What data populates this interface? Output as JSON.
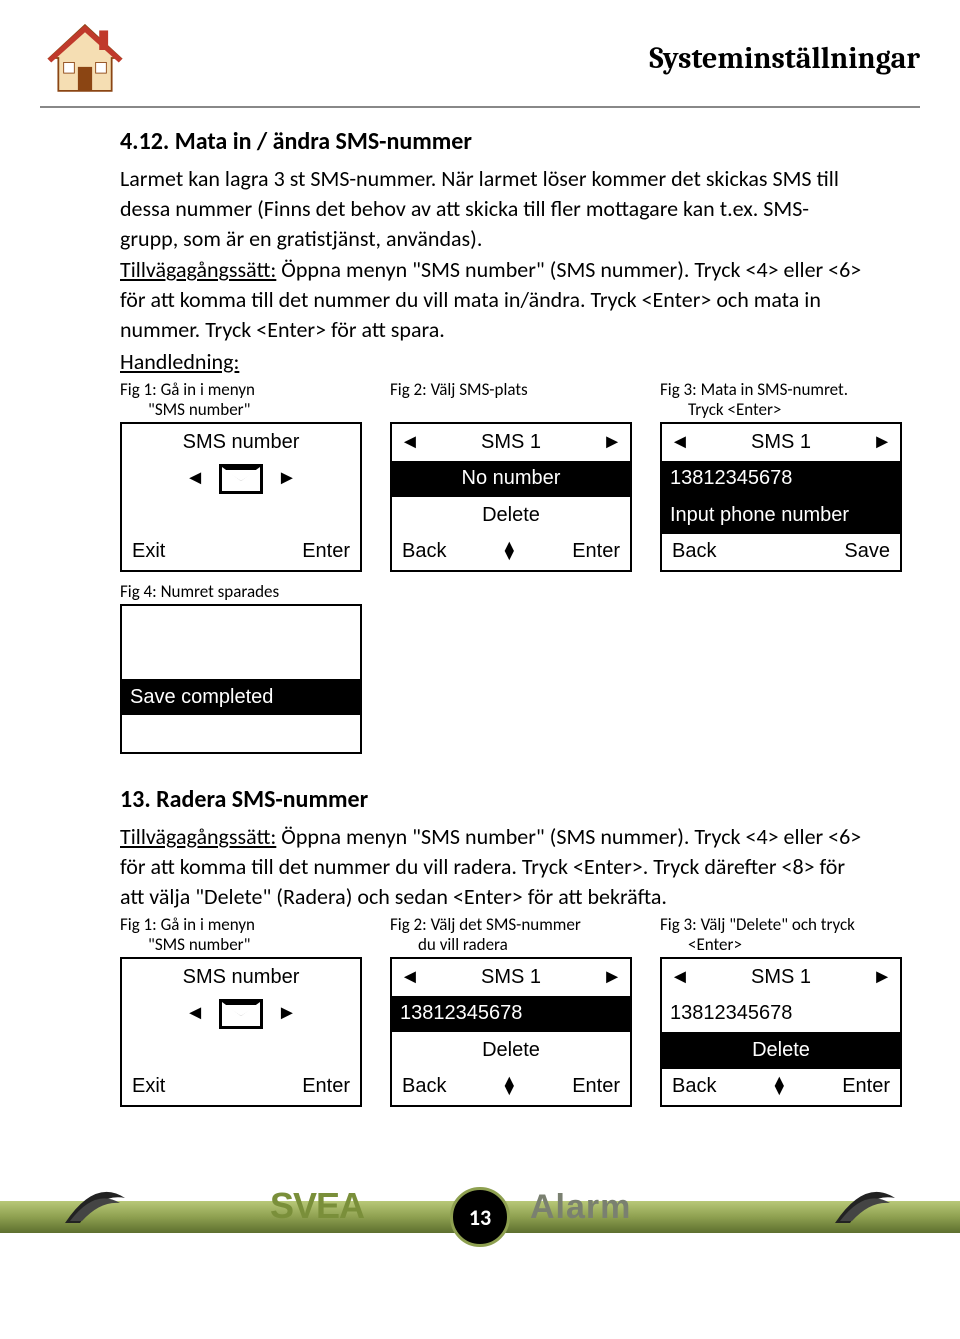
{
  "header": {
    "title": "Systeminställningar"
  },
  "section1": {
    "title": "4.12. Mata in / ändra SMS-nummer",
    "p1": "Larmet kan lagra 3 st SMS-nummer. När larmet löser kommer det skickas SMS till dessa nummer (Finns det behov av att skicka till fler mottagare kan t.ex. SMS-grupp, som är en gratistjänst, användas).",
    "tv_label": "Tillvägagångssätt:",
    "tv_text": " Öppna menyn \"SMS number\" (SMS nummer). Tryck <4> eller <6> för att komma till det nummer du vill mata in/ändra. Tryck <Enter> och mata in nummer. Tryck <Enter> för att spara.",
    "handledning": "Handledning:",
    "figs": {
      "f1": {
        "cap1": "Fig 1: Gå in i menyn",
        "cap2": "\"SMS number\"",
        "r1": "SMS number",
        "r4l": "Exit",
        "r4r": "Enter"
      },
      "f2": {
        "cap": "Fig 2: Välj SMS-plats",
        "r1": "SMS  1",
        "r2": "No  number",
        "r3": "Delete",
        "r4l": "Back",
        "r4r": "Enter"
      },
      "f3": {
        "cap1": "Fig 3: Mata in SMS-numret.",
        "cap2": "Tryck <Enter>",
        "r1": "SMS  1",
        "r2": "13812345678",
        "r3": "Input  phone number",
        "r4l": "Back",
        "r4r": "Save"
      },
      "f4": {
        "cap": "Fig 4: Numret sparades",
        "msg": "Save completed"
      }
    }
  },
  "section2": {
    "title": "13. Radera SMS-nummer",
    "tv_label": "Tillvägagångssätt:",
    "tv_text": " Öppna menyn \"SMS number\" (SMS nummer). Tryck <4> eller <6> för att komma till det nummer du vill radera. Tryck <Enter>. Tryck därefter <8> för att välja \"Delete\" (Radera) och sedan <Enter> för att bekräfta.",
    "figs": {
      "f1": {
        "cap1": "Fig 1: Gå in i menyn",
        "cap2": "\"SMS number\"",
        "r1": "SMS number",
        "r4l": "Exit",
        "r4r": "Enter"
      },
      "f2": {
        "cap1": "Fig 2: Välj det SMS-nummer",
        "cap2": "du vill radera",
        "r1": "SMS  1",
        "r2": "13812345678",
        "r3": "Delete",
        "r4l": "Back",
        "r4r": "Enter"
      },
      "f3": {
        "cap1": "Fig 3: Välj \"Delete\" och tryck",
        "cap2": "<Enter>",
        "r1": "SMS  1",
        "r2": "13812345678",
        "r3": "Delete",
        "r4l": "Back",
        "r4r": "Enter"
      }
    }
  },
  "footer": {
    "page": "13",
    "brand1": "SVEA",
    "brand2": "Alarm"
  }
}
